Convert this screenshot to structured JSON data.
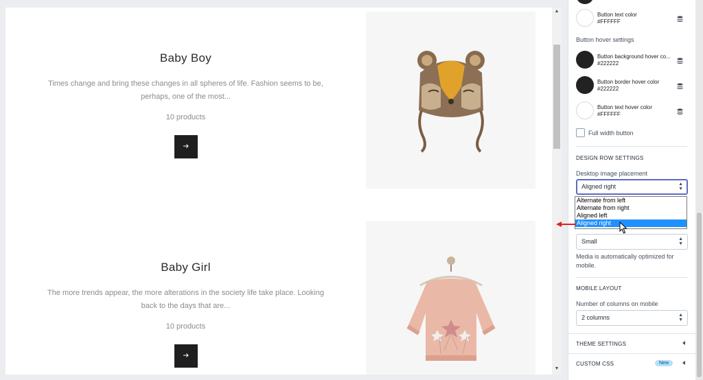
{
  "preview": {
    "rows": [
      {
        "title": "Baby Boy",
        "description": "Times change and bring these changes in all spheres of life. Fashion seems to be, perhaps, one of the most...",
        "count": "10 products"
      },
      {
        "title": "Baby Girl",
        "description": "The more trends appear, the more alterations in the society life take place. Looking back to the days that are...",
        "count": "10 products"
      }
    ]
  },
  "settings": {
    "button_text_color": {
      "label": "Button text color",
      "hex": "#FFFFFF"
    },
    "button_hover_settings": "Button hover settings",
    "hover_colors": [
      {
        "label": "Button background hover co...",
        "hex": "#222222"
      },
      {
        "label": "Button border hover color",
        "hex": "#222222"
      },
      {
        "label": "Button text hover color",
        "hex": "#FFFFFF"
      }
    ],
    "full_width_button": "Full width button",
    "design_row_heading": "DESIGN ROW SETTINGS",
    "desktop_image_placement_label": "Desktop image placement",
    "desktop_image_placement_value": "Aligned right",
    "dropdown_options": [
      "Alternate from left",
      "Alternate from right",
      "Aligned left",
      "Aligned right"
    ],
    "dropdown_selected_index": 3,
    "mobile_media_value": "Small",
    "media_note": "Media is automatically optimized for mobile.",
    "mobile_layout_heading": "MOBILE LAYOUT",
    "columns_label": "Number of columns on mobile",
    "columns_value": "2 columns",
    "theme_settings": "THEME SETTINGS",
    "custom_css": "CUSTOM CSS",
    "new_badge": "New"
  },
  "colors": {
    "dark_swatch": "#222222",
    "accent": "#5c6ac4",
    "selected_option": "#1e90ff",
    "annotation_arrow": "#e02020"
  }
}
